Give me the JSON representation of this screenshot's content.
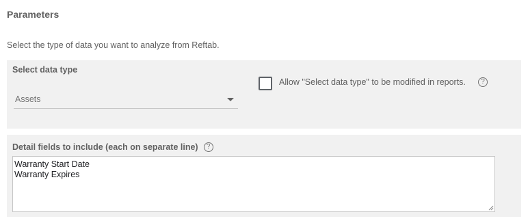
{
  "section": {
    "title": "Parameters",
    "description": "Select the type of data you want to analyze from Reftab."
  },
  "data_type": {
    "label": "Select data type",
    "selected_value": "Assets",
    "allow_modify_label": "Allow \"Select data type\" to be modified in reports.",
    "allow_modify_checked": false,
    "help_icon": "help-icon"
  },
  "detail_fields": {
    "label": "Detail fields to include (each on separate line)",
    "help_icon": "help-icon",
    "lines": [
      "Warranty Start Date",
      "Warranty Expires"
    ]
  },
  "colors": {
    "panel_bg": "#f1f1f1",
    "text": "#616161"
  }
}
